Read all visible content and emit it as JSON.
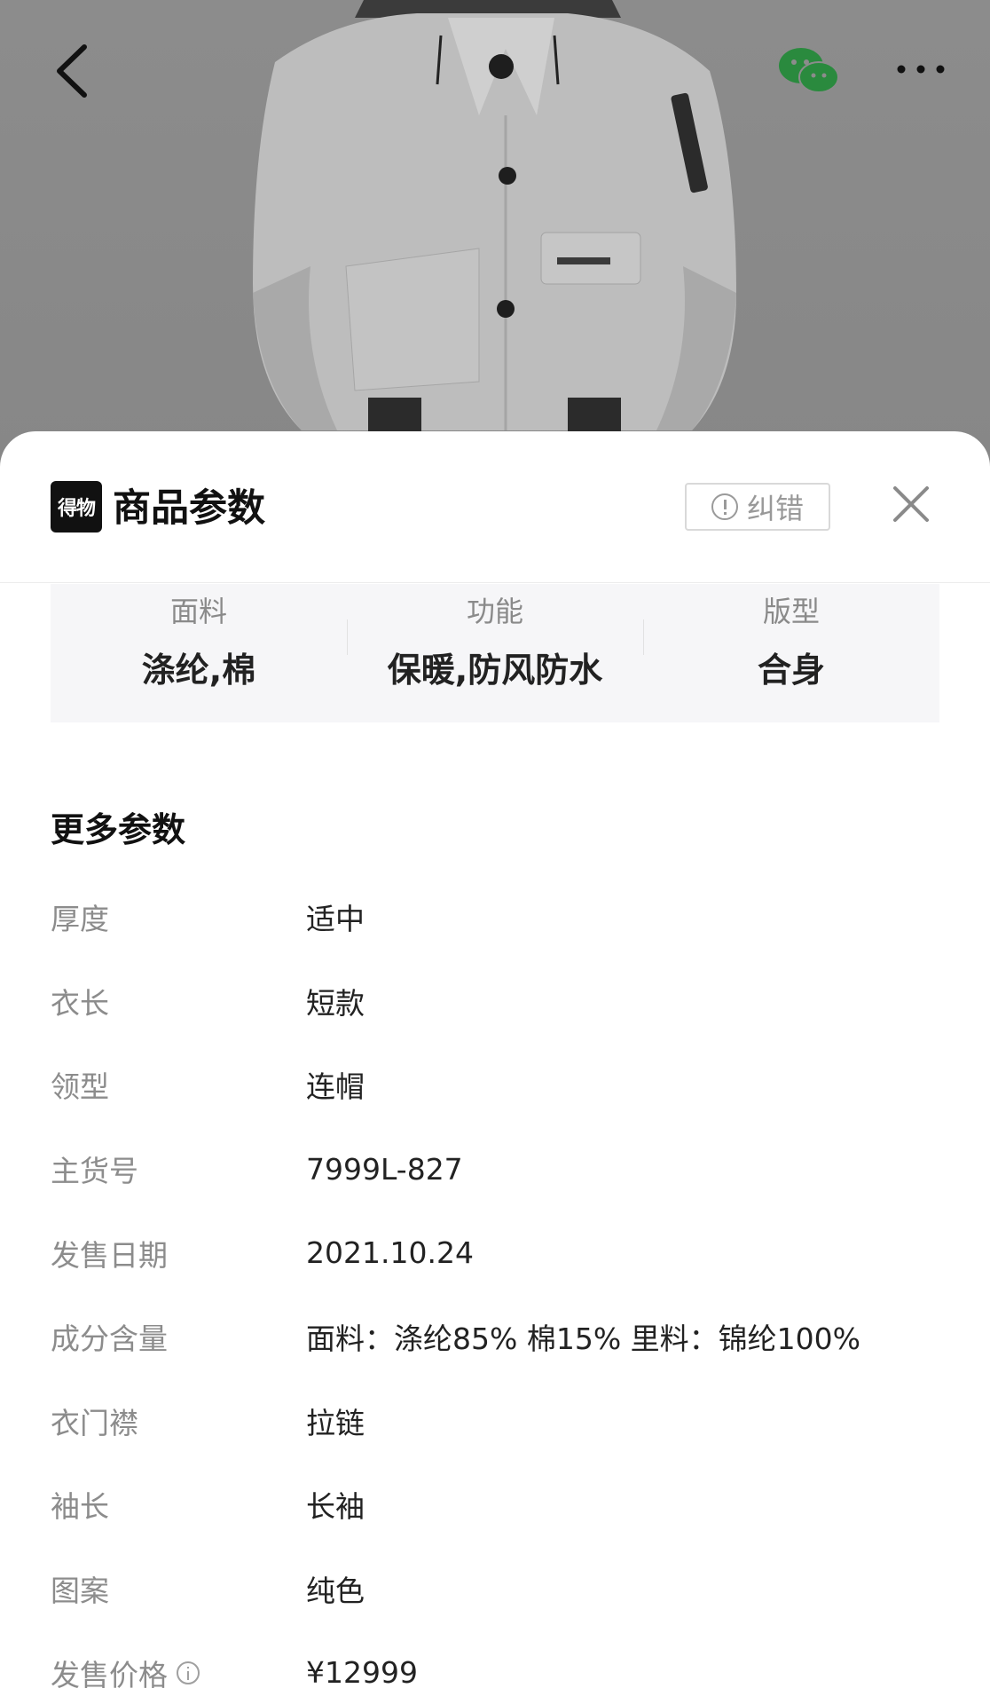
{
  "sheet": {
    "brand_logo_text": "得物",
    "title": "商品参数",
    "report_label": "纠错"
  },
  "key_params": [
    {
      "label": "面料",
      "value": "涤纶,棉"
    },
    {
      "label": "功能",
      "value": "保暖,防风防水"
    },
    {
      "label": "版型",
      "value": "合身"
    }
  ],
  "more_params": {
    "title": "更多参数",
    "rows": [
      {
        "key": "厚度",
        "value": "适中"
      },
      {
        "key": "衣长",
        "value": "短款"
      },
      {
        "key": "领型",
        "value": "连帽"
      },
      {
        "key": "主货号",
        "value": "7999L-827"
      },
      {
        "key": "发售日期",
        "value": "2021.10.24"
      },
      {
        "key": "成分含量",
        "value": "面料：涤纶85% 棉15% 里料：锦纶100%"
      },
      {
        "key": "衣门襟",
        "value": "拉链"
      },
      {
        "key": "袖长",
        "value": "长袖"
      },
      {
        "key": "图案",
        "value": "纯色"
      },
      {
        "key": "发售价格",
        "value": "¥12999"
      }
    ]
  }
}
